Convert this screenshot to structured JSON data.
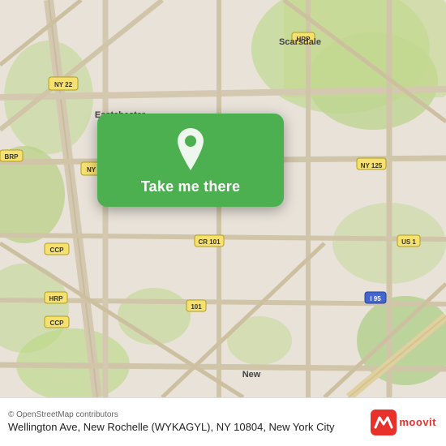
{
  "map": {
    "alt": "Map of Wellington Ave, New Rochelle area"
  },
  "overlay": {
    "button_label": "Take me there",
    "pin_alt": "location pin"
  },
  "bottom_bar": {
    "attribution": "© OpenStreetMap contributors",
    "address": "Wellington Ave, New Rochelle (WYKAGYL), NY 10804, New York City"
  },
  "moovit": {
    "logo_text": "moovit"
  }
}
